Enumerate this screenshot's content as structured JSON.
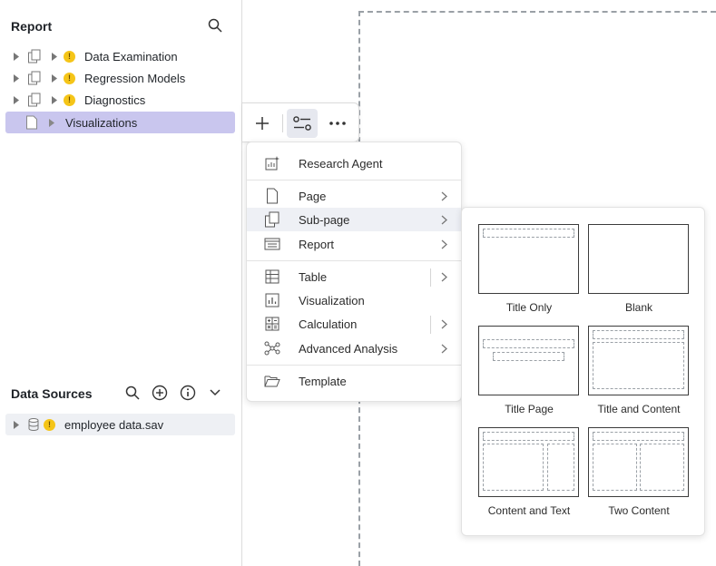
{
  "report": {
    "title": "Report",
    "items": [
      {
        "label": "Data Examination",
        "warning": true
      },
      {
        "label": "Regression Models",
        "warning": true
      },
      {
        "label": "Diagnostics",
        "warning": true
      },
      {
        "label": "Visualizations",
        "warning": false,
        "selected": true
      }
    ]
  },
  "data_sources": {
    "title": "Data Sources",
    "items": [
      {
        "label": "employee data.sav",
        "warning": true
      }
    ]
  },
  "toolbar": {
    "buttons": [
      "add-icon",
      "insert-layout-icon",
      "more-icon"
    ]
  },
  "insert_menu": {
    "items": [
      {
        "label": "Research Agent",
        "icon": "research-agent-icon"
      },
      {
        "label": "Page",
        "icon": "page-icon",
        "has_submenu": true
      },
      {
        "label": "Sub-page",
        "icon": "subpage-icon",
        "has_submenu": true,
        "hovered": true
      },
      {
        "label": "Report",
        "icon": "report-icon",
        "has_submenu": true
      },
      {
        "label": "Table",
        "icon": "table-icon",
        "has_submenu": true
      },
      {
        "label": "Visualization",
        "icon": "chart-icon"
      },
      {
        "label": "Calculation",
        "icon": "calculator-icon",
        "has_submenu": true
      },
      {
        "label": "Advanced Analysis",
        "icon": "network-icon",
        "has_submenu": true
      },
      {
        "label": "Template",
        "icon": "folder-open-icon"
      }
    ]
  },
  "layouts": {
    "items": [
      {
        "label": "Title Only"
      },
      {
        "label": "Blank"
      },
      {
        "label": "Title Page"
      },
      {
        "label": "Title and Content"
      },
      {
        "label": "Content and Text"
      },
      {
        "label": "Two Content"
      }
    ]
  },
  "colors": {
    "selection": "#c9c6ee",
    "warning": "#f5c518",
    "hover": "#eef0f5"
  }
}
